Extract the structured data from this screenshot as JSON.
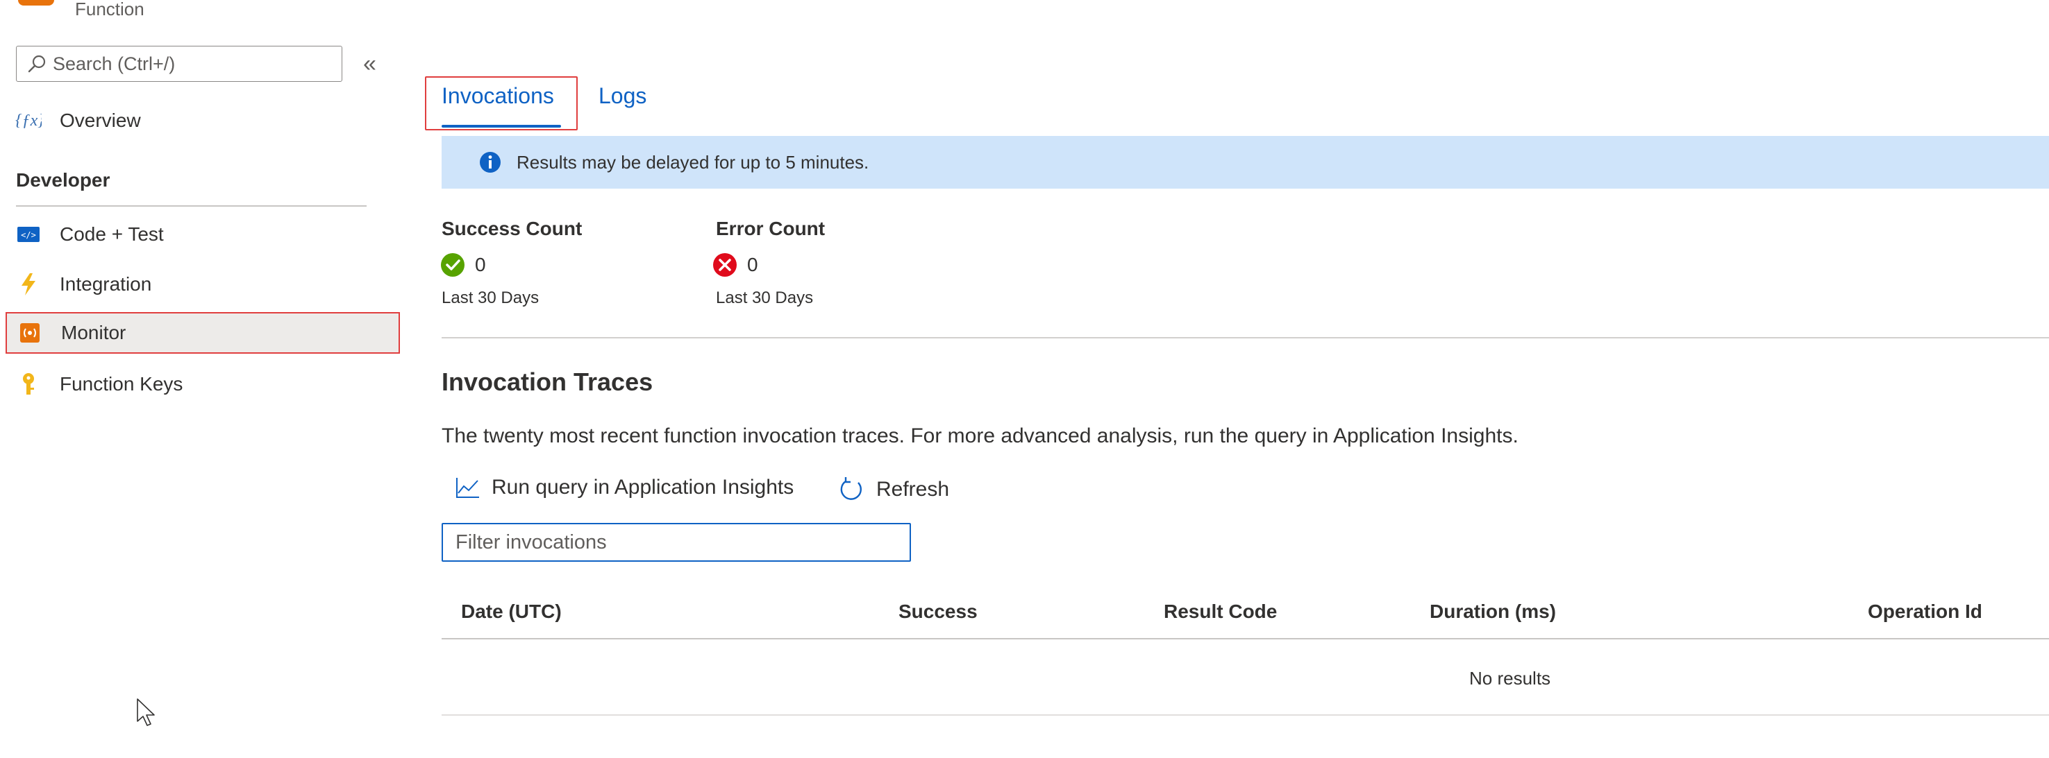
{
  "header": {
    "subtitle": "Function"
  },
  "sidebar": {
    "search_placeholder": "Search (Ctrl+/)",
    "collapse_label": "«",
    "overview_label": "Overview",
    "section_title": "Developer",
    "items": [
      {
        "label": "Code + Test",
        "icon": "code-icon"
      },
      {
        "label": "Integration",
        "icon": "lightning-icon"
      },
      {
        "label": "Monitor",
        "icon": "monitor-icon",
        "selected": true
      },
      {
        "label": "Function Keys",
        "icon": "key-icon"
      }
    ]
  },
  "tabs": [
    {
      "label": "Invocations",
      "active": true
    },
    {
      "label": "Logs",
      "active": false
    }
  ],
  "banner": {
    "text": "Results may be delayed for up to 5 minutes.",
    "icon": "info-icon"
  },
  "counts": {
    "success": {
      "title": "Success Count",
      "value": "0",
      "period": "Last 30 Days",
      "icon": "check-circle-icon"
    },
    "error": {
      "title": "Error Count",
      "value": "0",
      "period": "Last 30 Days",
      "icon": "error-circle-icon"
    }
  },
  "traces": {
    "title": "Invocation Traces",
    "description": "The twenty most recent function invocation traces. For more advanced analysis, run the query in Application Insights.",
    "run_query_label": "Run query in Application Insights",
    "refresh_label": "Refresh",
    "filter_placeholder": "Filter invocations",
    "columns": [
      "Date (UTC)",
      "Success",
      "Result Code",
      "Duration (ms)",
      "Operation Id"
    ],
    "empty_text": "No results"
  },
  "colors": {
    "accent": "#0f62c4",
    "highlight_border": "#e03e3e",
    "banner_bg": "#cfe4fa",
    "success": "#57a300",
    "error": "#e00b1c",
    "brand_orange": "#e8730c"
  }
}
